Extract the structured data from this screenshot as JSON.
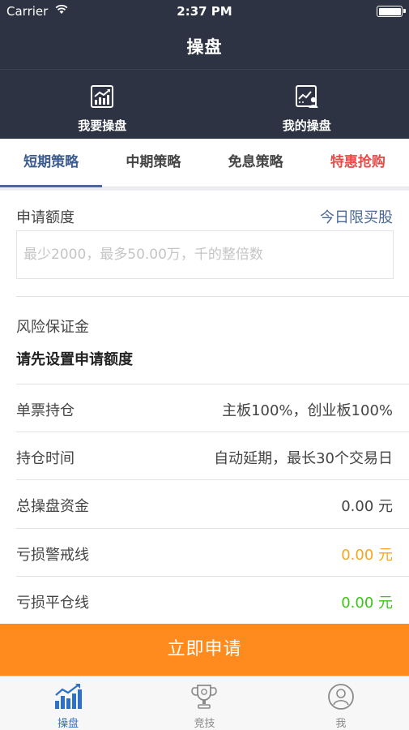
{
  "status_bar": {
    "carrier": "Carrier",
    "time": "2:37 PM"
  },
  "nav": {
    "title": "操盘"
  },
  "quick_actions": [
    {
      "label": "我要操盘",
      "icon": "chart-trend-icon"
    },
    {
      "label": "我的操盘",
      "icon": "user-chart-icon"
    }
  ],
  "tabs": [
    {
      "label": "短期策略",
      "active": true
    },
    {
      "label": "中期策略",
      "active": false
    },
    {
      "label": "免息策略",
      "active": false
    },
    {
      "label": "特惠抢购",
      "active": false,
      "highlight": true
    }
  ],
  "form": {
    "apply_amount_label": "申请额度",
    "limit_link": "今日限买股",
    "amount_placeholder": "最少2000，最多50.00万，千的整倍数",
    "amount_value": "",
    "risk_margin_label": "风险保证金",
    "risk_margin_note": "请先设置申请额度",
    "single_stock_label": "单票持仓",
    "single_stock_value": "主板100%，创业板100%",
    "hold_time_label": "持仓时间",
    "hold_time_value": "自动延期，最长30个交易日",
    "total_funds_label": "总操盘资金",
    "total_funds_value": "0.00 元",
    "warning_line_label": "亏损警戒线",
    "warning_line_value": "0.00 元",
    "stop_line_label": "亏损平仓线",
    "stop_line_value": "0.00 元"
  },
  "submit_label": "立即申请",
  "tabbar": [
    {
      "label": "操盘",
      "icon": "bar-chart-icon",
      "active": true
    },
    {
      "label": "竞技",
      "icon": "trophy-icon",
      "active": false
    },
    {
      "label": "我",
      "icon": "person-icon",
      "active": false
    }
  ],
  "colors": {
    "header_bg": "#2d3342",
    "accent_blue": "#4a6898",
    "highlight_red": "#e84b48",
    "submit_orange": "#ff8a1d",
    "warning_orange": "#f5a623",
    "stop_green": "#3cc417",
    "tabbar_active": "#2f71c6"
  }
}
